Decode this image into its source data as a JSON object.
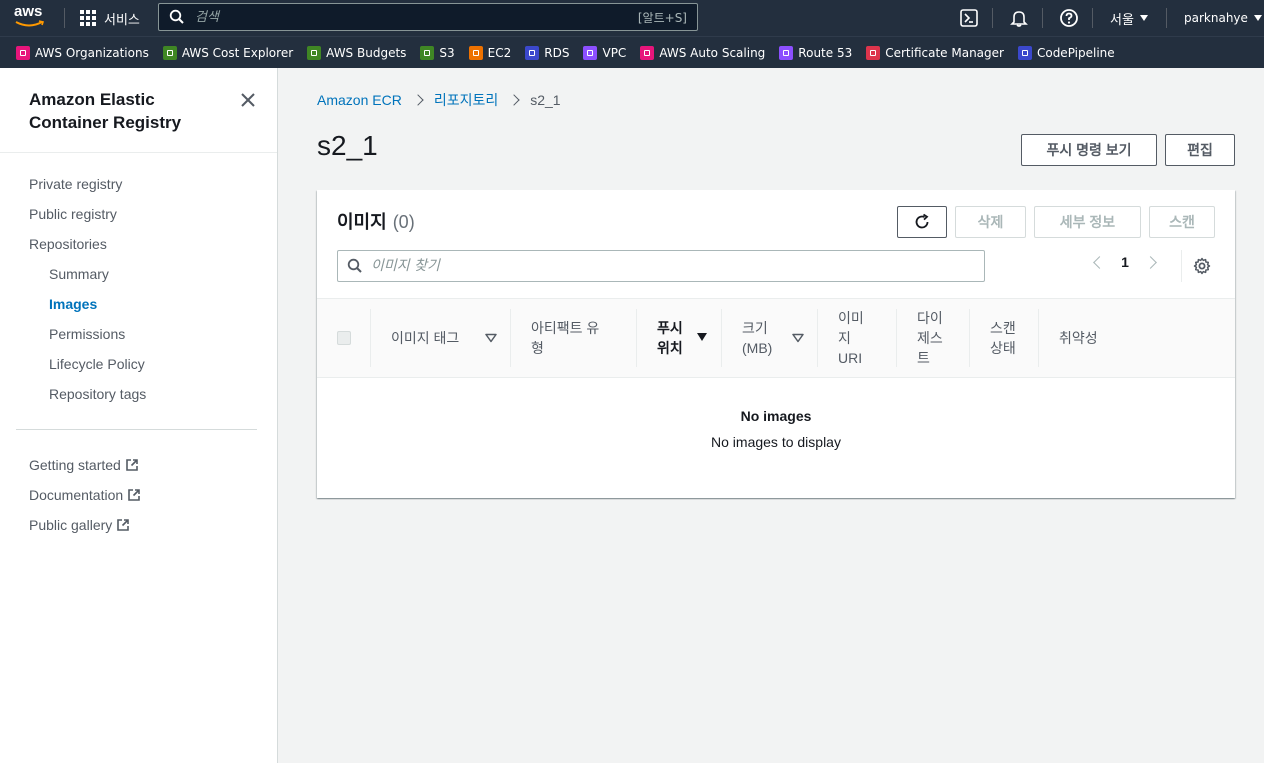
{
  "topnav": {
    "logo": "aws",
    "services_label": "서비스",
    "search_placeholder": "검색",
    "search_shortcut": "[알트+S]",
    "region": "서울",
    "user": "parknahye"
  },
  "favorites": [
    {
      "label": "AWS Organizations",
      "color": "#e7157b"
    },
    {
      "label": "AWS Cost Explorer",
      "color": "#3f8624"
    },
    {
      "label": "AWS Budgets",
      "color": "#3f8624"
    },
    {
      "label": "S3",
      "color": "#3f8624"
    },
    {
      "label": "EC2",
      "color": "#ed7100"
    },
    {
      "label": "RDS",
      "color": "#3b48cc"
    },
    {
      "label": "VPC",
      "color": "#8c4fff"
    },
    {
      "label": "AWS Auto Scaling",
      "color": "#e7157b"
    },
    {
      "label": "Route 53",
      "color": "#8c4fff"
    },
    {
      "label": "Certificate Manager",
      "color": "#dd344c"
    },
    {
      "label": "CodePipeline",
      "color": "#3b48cc"
    }
  ],
  "sidebar": {
    "title": "Amazon Elastic Container Registry",
    "items": [
      {
        "label": "Private registry"
      },
      {
        "label": "Public registry"
      },
      {
        "label": "Repositories"
      },
      {
        "label": "Summary"
      },
      {
        "label": "Images"
      },
      {
        "label": "Permissions"
      },
      {
        "label": "Lifecycle Policy"
      },
      {
        "label": "Repository tags"
      }
    ],
    "links": [
      {
        "label": "Getting started"
      },
      {
        "label": "Documentation"
      },
      {
        "label": "Public gallery"
      }
    ]
  },
  "breadcrumb": {
    "items": [
      "Amazon ECR",
      "리포지토리",
      "s2_1"
    ]
  },
  "page": {
    "title": "s2_1",
    "push_commands_label": "푸시 명령 보기",
    "edit_label": "편집"
  },
  "images_panel": {
    "title": "이미지",
    "count": "(0)",
    "delete_label": "삭제",
    "details_label": "세부 정보",
    "scan_label": "스캔",
    "filter_placeholder": "이미지 찾기",
    "page_number": "1",
    "columns": [
      "이미지 태그",
      "아티팩트 유형",
      "푸시 위치",
      "크기 (MB)",
      "이미지 URI",
      "다이제스트",
      "스캔 상태",
      "취약성"
    ],
    "column_lines": {
      "artifact": [
        "아티팩트 유",
        "형"
      ],
      "pushed": [
        "푸시",
        "위치"
      ],
      "size": [
        "크기",
        "(MB)"
      ],
      "uri": [
        "이미",
        "지",
        "URI"
      ],
      "digest": [
        "다이",
        "제스",
        "트"
      ],
      "scan": [
        "스캔",
        "상태"
      ]
    },
    "empty_title": "No images",
    "empty_subtitle": "No images to display"
  }
}
